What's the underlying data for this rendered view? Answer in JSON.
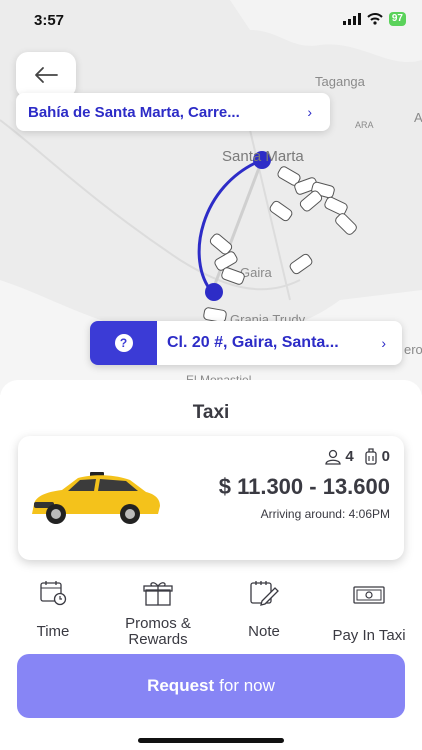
{
  "status": {
    "time": "3:57",
    "battery": "97"
  },
  "map": {
    "labels": {
      "taganga": "Taganga",
      "santa_marta": "Santa Marta",
      "gaira": "Gaira",
      "grania": "Grania Trudy",
      "rero": "ero",
      "ara": "ARA",
      "a_right": "A",
      "monastiel": "El Monastiel"
    }
  },
  "origin": {
    "label": "Bahía de Santa Marta, Carre..."
  },
  "destination": {
    "label": "Cl. 20 #, Gaira, Santa...",
    "badge": "?"
  },
  "service": {
    "title": "Taxi",
    "passengers": "4",
    "luggage": "0",
    "price": "$ 11.300 - 13.600",
    "arriving": "Arriving around: 4:06PM"
  },
  "options": [
    {
      "label": "Time",
      "icon": "calendar-clock-icon"
    },
    {
      "label": "Promos & Rewards",
      "icon": "gift-icon"
    },
    {
      "label": "Note",
      "icon": "note-edit-icon"
    },
    {
      "label": "Pay In Taxi",
      "icon": "cash-icon"
    }
  ],
  "request": {
    "bold": "Request",
    "rest": "for now"
  },
  "colors": {
    "accent": "#2d2cc7",
    "button": "#8785f5",
    "route": "#2d2cc7"
  }
}
